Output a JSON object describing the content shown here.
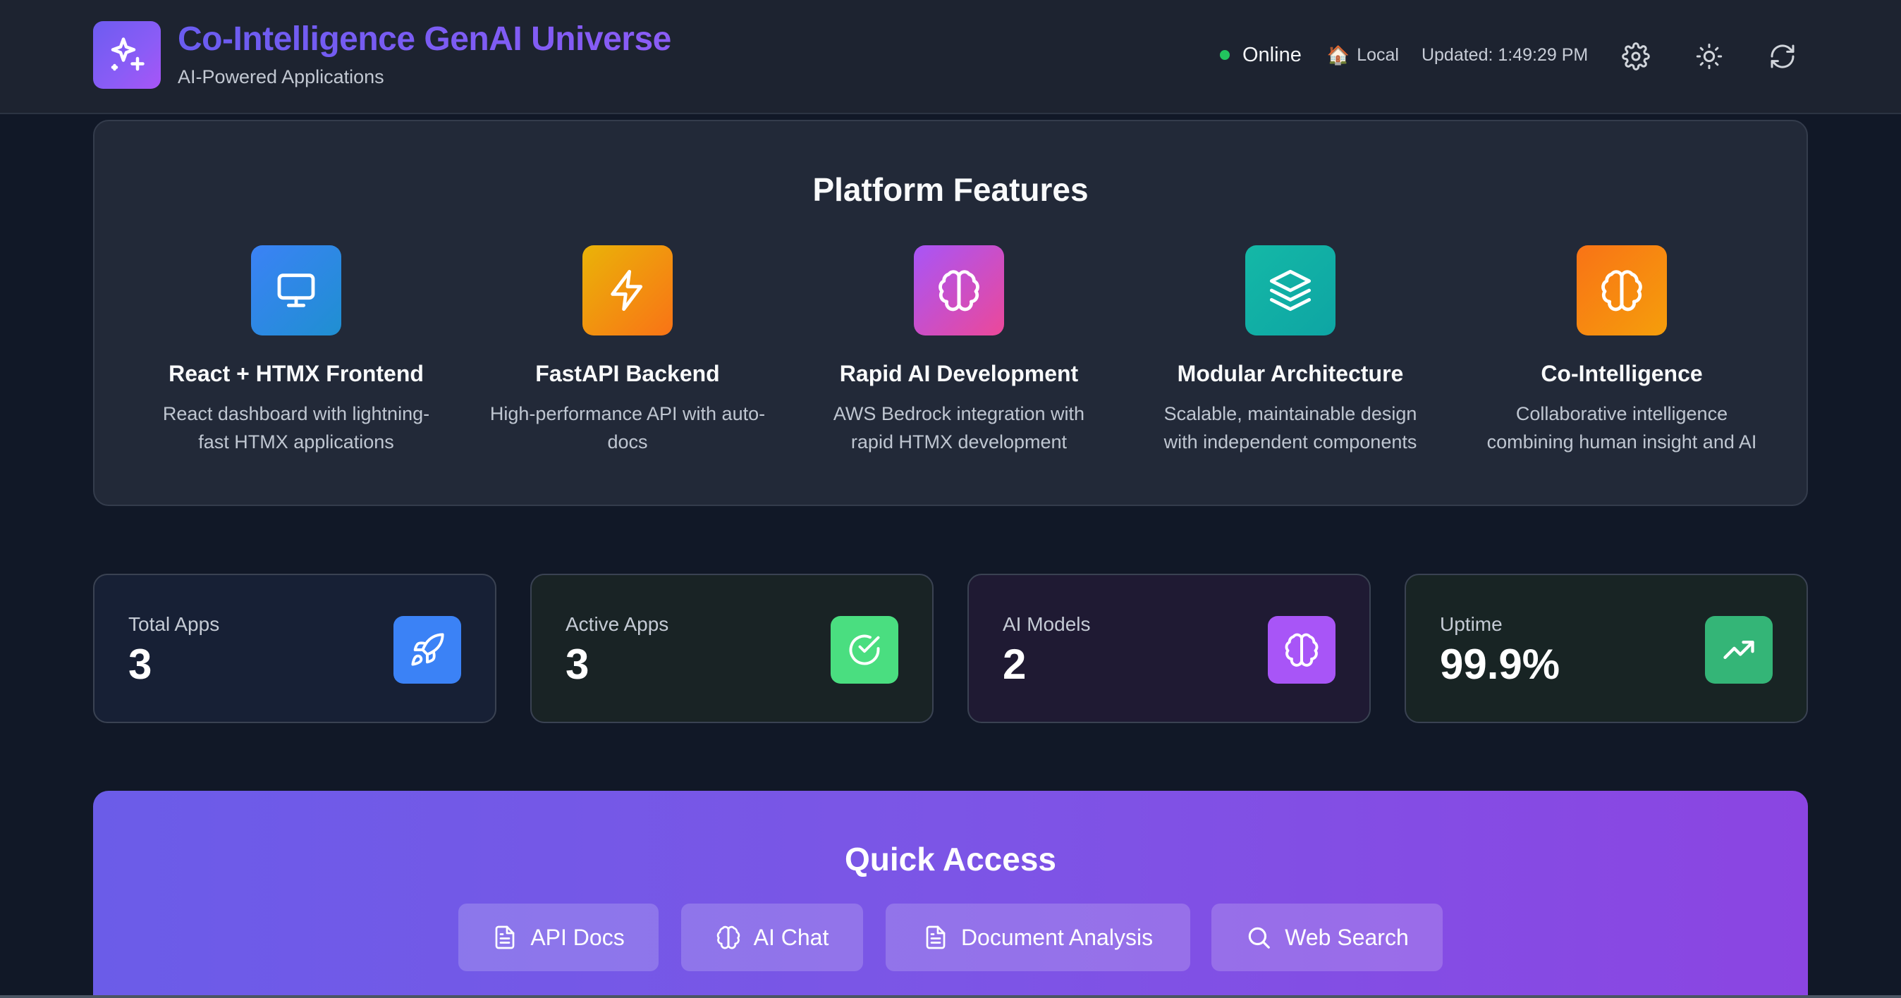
{
  "header": {
    "title": "Co-Intelligence GenAI Universe",
    "subtitle": "AI-Powered Applications",
    "status": "Online",
    "environment_icon": "🏠",
    "environment": "Local",
    "updated": "Updated: 1:49:29 PM",
    "icons": [
      "sparkles-icon",
      "settings-gear-icon",
      "sun-icon",
      "refresh-icon"
    ],
    "status_color": "#22c55e"
  },
  "features": {
    "title": "Platform Features",
    "items": [
      {
        "title": "React + HTMX Frontend",
        "desc": "React dashboard with lightning-fast HTMX applications",
        "icon": "monitor-icon"
      },
      {
        "title": "FastAPI Backend",
        "desc": "High-performance API with auto-docs",
        "icon": "lightning-bolt-icon"
      },
      {
        "title": "Rapid AI Development",
        "desc": "AWS Bedrock integration with rapid HTMX development",
        "icon": "brain-icon"
      },
      {
        "title": "Modular Architecture",
        "desc": "Scalable, maintainable design with independent components",
        "icon": "layers-icon"
      },
      {
        "title": "Co-Intelligence",
        "desc": "Collaborative intelligence combining human insight and AI",
        "icon": "brain-icon"
      }
    ]
  },
  "stats": [
    {
      "label": "Total Apps",
      "value": "3",
      "icon": "rocket-icon",
      "color": "#3b82f6"
    },
    {
      "label": "Active Apps",
      "value": "3",
      "icon": "check-circle-icon",
      "color": "#4ade80"
    },
    {
      "label": "AI Models",
      "value": "2",
      "icon": "brain-icon",
      "color": "#a855f7"
    },
    {
      "label": "Uptime",
      "value": "99.9%",
      "icon": "trending-up-icon",
      "color": "#34d399"
    }
  ],
  "quick_access": {
    "title": "Quick Access",
    "buttons": [
      {
        "label": "API Docs",
        "icon": "document-icon"
      },
      {
        "label": "AI Chat",
        "icon": "brain-icon"
      },
      {
        "label": "Document Analysis",
        "icon": "document-icon"
      },
      {
        "label": "Web Search",
        "icon": "search-icon"
      }
    ]
  }
}
